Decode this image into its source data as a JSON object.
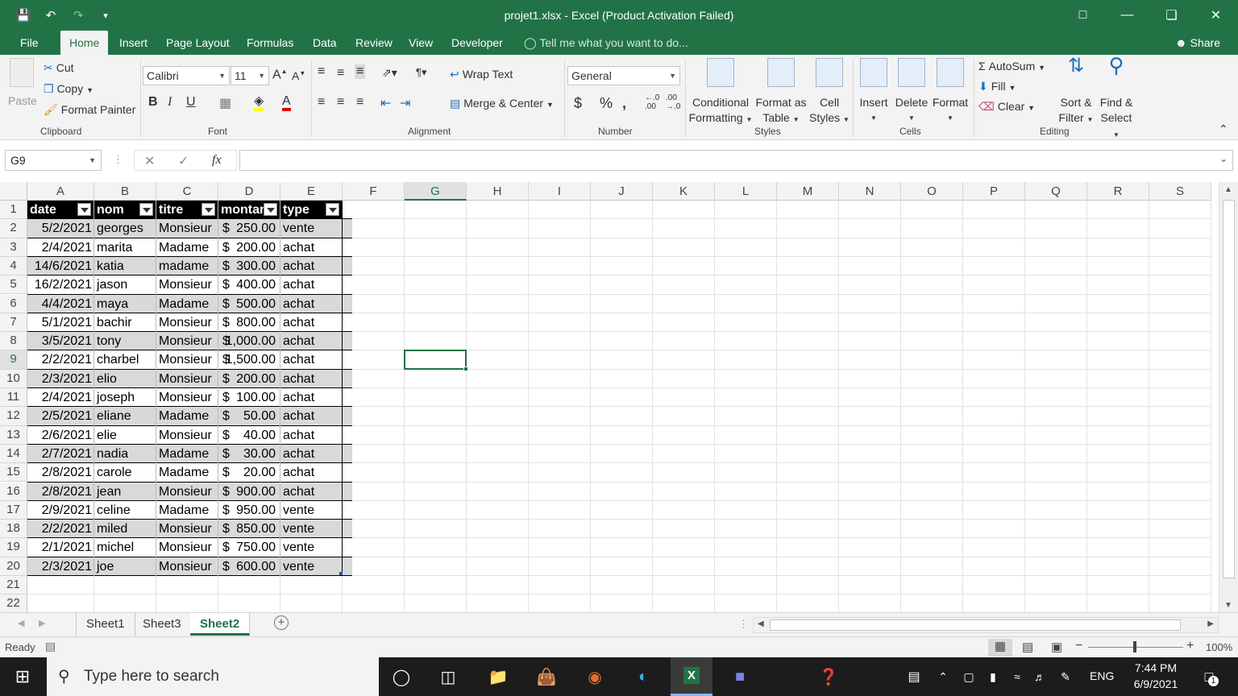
{
  "window": {
    "title": "projet1.xlsx - Excel (Product Activation Failed)"
  },
  "tabs": [
    "File",
    "Home",
    "Insert",
    "Page Layout",
    "Formulas",
    "Data",
    "Review",
    "View",
    "Developer"
  ],
  "tell_me": "Tell me what you want to do...",
  "share": "Share",
  "ribbon": {
    "clipboard": {
      "paste": "Paste",
      "cut": "Cut",
      "copy": "Copy",
      "format_painter": "Format Painter",
      "label": "Clipboard"
    },
    "font": {
      "name": "Calibri",
      "size": "11",
      "label": "Font"
    },
    "alignment": {
      "wrap_text": "Wrap Text",
      "merge_center": "Merge & Center",
      "label": "Alignment"
    },
    "number": {
      "format": "General",
      "label": "Number"
    },
    "styles": {
      "conditional_1": "Conditional",
      "conditional_2": "Formatting",
      "format_table_1": "Format as",
      "format_table_2": "Table",
      "cell_styles_1": "Cell",
      "cell_styles_2": "Styles",
      "label": "Styles"
    },
    "cells": {
      "insert": "Insert",
      "delete": "Delete",
      "format": "Format",
      "label": "Cells"
    },
    "editing": {
      "autosum": "AutoSum",
      "fill": "Fill",
      "clear": "Clear",
      "sort_1": "Sort &",
      "sort_2": "Filter",
      "find_1": "Find &",
      "find_2": "Select",
      "label": "Editing"
    }
  },
  "formula_bar": {
    "name_box": "G9",
    "formula": ""
  },
  "columns": [
    "A",
    "B",
    "C",
    "D",
    "E",
    "F",
    "G",
    "H",
    "I",
    "J",
    "K",
    "L",
    "M",
    "N",
    "O",
    "P",
    "Q",
    "R",
    "S"
  ],
  "selected_column": "G",
  "selected_row": 9,
  "table": {
    "headers": [
      "date",
      "nom",
      "titre",
      "montant",
      "type"
    ],
    "rows": [
      [
        "5/2/2021",
        "georges",
        "Monsieur",
        "$",
        "250.00",
        "vente"
      ],
      [
        "2/4/2021",
        "marita",
        "Madame",
        "$",
        "200.00",
        "achat"
      ],
      [
        "14/6/2021",
        "katia",
        "madame",
        "$",
        "300.00",
        "achat"
      ],
      [
        "16/2/2021",
        "jason",
        "Monsieur",
        "$",
        "400.00",
        "achat"
      ],
      [
        "4/4/2021",
        "maya",
        "Madame",
        "$",
        "500.00",
        "achat"
      ],
      [
        "5/1/2021",
        "bachir",
        "Monsieur",
        "$",
        "800.00",
        "achat"
      ],
      [
        "3/5/2021",
        "tony",
        "Monsieur",
        "$",
        "1,000.00",
        "achat"
      ],
      [
        "2/2/2021",
        "charbel",
        "Monsieur",
        "$",
        "1,500.00",
        "achat"
      ],
      [
        "2/3/2021",
        "elio",
        "Monsieur",
        "$",
        "200.00",
        "achat"
      ],
      [
        "2/4/2021",
        "joseph",
        "Monsieur",
        "$",
        "100.00",
        "achat"
      ],
      [
        "2/5/2021",
        "eliane",
        "Madame",
        "$",
        "50.00",
        "achat"
      ],
      [
        "2/6/2021",
        "elie",
        "Monsieur",
        "$",
        "40.00",
        "achat"
      ],
      [
        "2/7/2021",
        "nadia",
        "Madame",
        "$",
        "30.00",
        "achat"
      ],
      [
        "2/8/2021",
        "carole",
        "Madame",
        "$",
        "20.00",
        "achat"
      ],
      [
        "2/8/2021",
        "jean",
        "Monsieur",
        "$",
        "900.00",
        "achat"
      ],
      [
        "2/9/2021",
        "celine",
        "Madame",
        "$",
        "950.00",
        "vente"
      ],
      [
        "2/2/2021",
        "miled",
        "Monsieur",
        "$",
        "850.00",
        "vente"
      ],
      [
        "2/1/2021",
        "michel",
        "Monsieur",
        "$",
        "750.00",
        "vente"
      ],
      [
        "2/3/2021",
        "joe",
        "Monsieur",
        "$",
        "600.00",
        "vente"
      ]
    ]
  },
  "sheets": [
    "Sheet1",
    "Sheet3",
    "Sheet2"
  ],
  "active_sheet": "Sheet2",
  "status": {
    "ready": "Ready",
    "zoom": "100%"
  },
  "taskbar": {
    "search_placeholder": "Type here to search",
    "time": "7:44 PM",
    "date": "6/9/2021",
    "lang": "ENG",
    "notifications": "1"
  },
  "colors": {
    "excel_green": "#217346",
    "header_black": "#000000",
    "band_gray": "#d9d9d9"
  }
}
